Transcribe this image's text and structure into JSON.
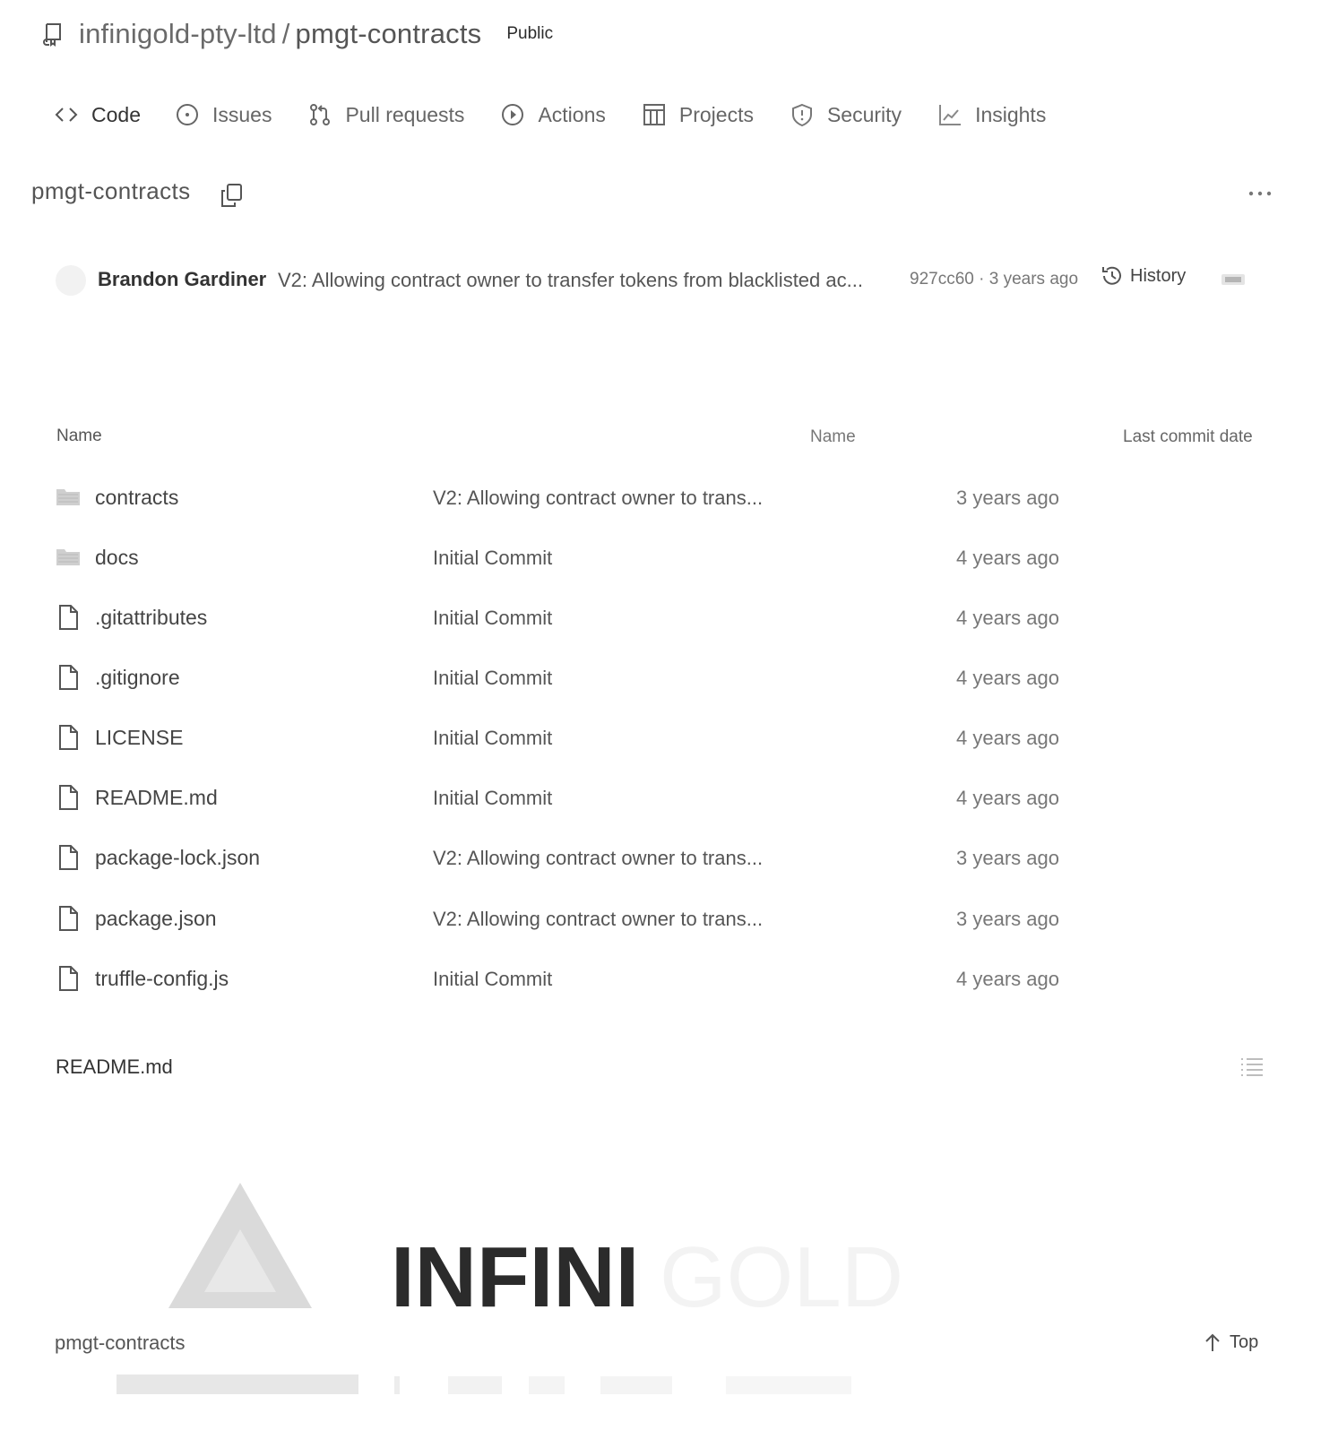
{
  "header": {
    "owner": "infinigold-pty-ltd",
    "separator": "/",
    "repo": "pmgt-contracts",
    "visibility": "Public",
    "repo_icon": "repo-icon"
  },
  "nav": {
    "tabs": [
      {
        "label": "Code",
        "icon": "code-icon"
      },
      {
        "label": "Issues",
        "icon": "issue-opened-icon"
      },
      {
        "label": "Pull requests",
        "icon": "git-pull-request-icon"
      },
      {
        "label": "Actions",
        "icon": "play-icon"
      },
      {
        "label": "Projects",
        "icon": "table-icon"
      },
      {
        "label": "Security",
        "icon": "shield-icon"
      },
      {
        "label": "Insights",
        "icon": "graph-icon"
      }
    ]
  },
  "repo_title": "pmgt-contracts",
  "latest_commit": {
    "author": "Brandon Gardiner",
    "message": "V2: Allowing contract owner to transfer tokens from blacklisted ac...",
    "hash": "927cc60",
    "meta_separator": "·",
    "time": "3 years ago",
    "history_label": "History"
  },
  "file_table": {
    "headers": {
      "name": "Name",
      "message": "Name",
      "date": "Last commit date"
    },
    "rows": [
      {
        "name": "contracts",
        "type": "folder",
        "message": "V2: Allowing contract owner to trans...",
        "date": "3 years ago"
      },
      {
        "name": "docs",
        "type": "folder",
        "message": "Initial Commit",
        "date": "4 years ago"
      },
      {
        "name": ".gitattributes",
        "type": "file",
        "message": "Initial Commit",
        "date": "4 years ago"
      },
      {
        "name": ".gitignore",
        "type": "file",
        "message": "Initial Commit",
        "date": "4 years ago"
      },
      {
        "name": "LICENSE",
        "type": "file",
        "message": "Initial Commit",
        "date": "4 years ago"
      },
      {
        "name": "README.md",
        "type": "file",
        "message": "Initial Commit",
        "date": "4 years ago"
      },
      {
        "name": "package-lock.json",
        "type": "file",
        "message": "V2: Allowing contract owner to trans...",
        "date": "3 years ago"
      },
      {
        "name": "package.json",
        "type": "file",
        "message": "V2: Allowing contract owner to trans...",
        "date": "3 years ago"
      },
      {
        "name": "truffle-config.js",
        "type": "file",
        "message": "Initial Commit",
        "date": "4 years ago"
      }
    ]
  },
  "readme": {
    "title": "README.md",
    "logo_text_bold": "INFINI",
    "logo_text_light": "GOLD"
  },
  "footer": {
    "repo": "pmgt-contracts",
    "top_label": "Top"
  },
  "colors": {
    "text": "#2a2a2a",
    "muted": "#777777",
    "logo_dark": "#2b2b2b",
    "logo_light": "#f3f3f3",
    "logo_triangle": "#d9d9d9"
  }
}
